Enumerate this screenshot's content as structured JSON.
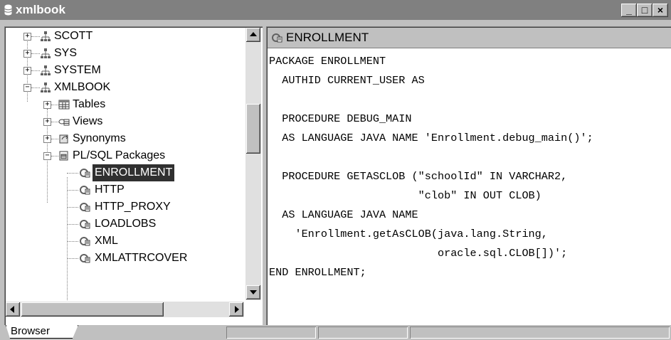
{
  "window": {
    "title": "xmlbook",
    "controls": {
      "minimize": "_",
      "maximize": "□",
      "close": "×"
    }
  },
  "tree": {
    "nodes": [
      {
        "label": "SCOTT",
        "icon": "user-schema-icon",
        "expander": "+"
      },
      {
        "label": "SYS",
        "icon": "user-schema-icon",
        "expander": "+"
      },
      {
        "label": "SYSTEM",
        "icon": "user-schema-icon",
        "expander": "+"
      },
      {
        "label": "XMLBOOK",
        "icon": "user-schema-icon",
        "expander": "−"
      },
      {
        "label": "Tables",
        "icon": "table-icon",
        "expander": "+"
      },
      {
        "label": "Views",
        "icon": "view-icon",
        "expander": "+"
      },
      {
        "label": "Synonyms",
        "icon": "synonym-icon",
        "expander": "+"
      },
      {
        "label": "PL/SQL Packages",
        "icon": "package-folder-icon",
        "expander": "−"
      },
      {
        "label": "ENROLLMENT",
        "icon": "package-icon",
        "selected": true
      },
      {
        "label": "HTTP",
        "icon": "package-icon"
      },
      {
        "label": "HTTP_PROXY",
        "icon": "package-icon"
      },
      {
        "label": "LOADLOBS",
        "icon": "package-icon"
      },
      {
        "label": "XML",
        "icon": "package-icon"
      },
      {
        "label": "XMLATTRCOVER",
        "icon": "package-icon"
      }
    ]
  },
  "editor": {
    "title": "ENROLLMENT",
    "icon": "package-icon",
    "code": "PACKAGE ENROLLMENT\n  AUTHID CURRENT_USER AS\n\n  PROCEDURE DEBUG_MAIN\n  AS LANGUAGE JAVA NAME 'Enrollment.debug_main()';\n\n  PROCEDURE GETASCLOB (\"schoolId\" IN VARCHAR2,\n                       \"clob\" IN OUT CLOB)\n  AS LANGUAGE JAVA NAME\n    'Enrollment.getAsCLOB(java.lang.String,\n                          oracle.sql.CLOB[])';\nEND ENROLLMENT;"
  },
  "statusbar": {
    "tab_label": "Browser"
  },
  "colors": {
    "titlebar": "#808080",
    "selection": "#303030",
    "chrome": "#c0c0c0"
  }
}
